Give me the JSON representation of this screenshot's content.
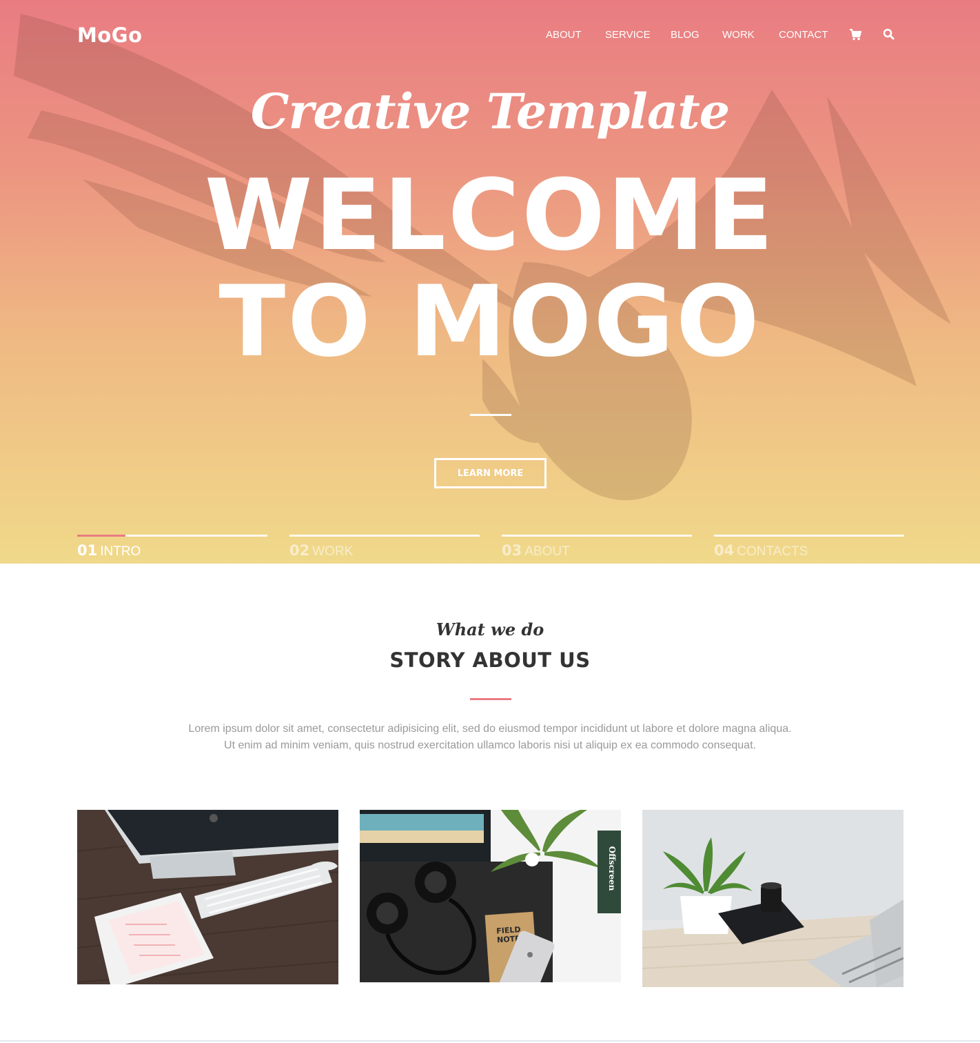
{
  "header": {
    "logo": "MoGo",
    "nav": [
      "ABOUT",
      "SERVICE",
      "BLOG",
      "WORK",
      "CONTACT"
    ],
    "icons": [
      "cart-icon",
      "search-icon"
    ]
  },
  "hero": {
    "script_title": "Creative Template",
    "title_line1": "WELCOME",
    "title_line2": "TO MOGO",
    "button_label": "LEARN MORE",
    "slider": [
      {
        "num": "01",
        "label": "INTRO",
        "active": true
      },
      {
        "num": "02",
        "label": "WORK",
        "active": false
      },
      {
        "num": "03",
        "label": "ABOUT",
        "active": false
      },
      {
        "num": "04",
        "label": "CONTACTS",
        "active": false
      }
    ]
  },
  "story": {
    "subheading": "What we do",
    "title": "STORY ABOUT US",
    "paragraph_line1": "Lorem ipsum dolor sit amet, consectetur adipisicing elit, sed do eiusmod tempor incididunt ut labore et dolore magna aliqua.",
    "paragraph_line2": "Ut enim ad minim veniam, quis nostrud exercitation ullamco laboris nisi ut aliquip ex ea commodo consequat.",
    "photos": [
      {
        "name": "desk-imac-photo"
      },
      {
        "name": "headphones-notebook-photo",
        "notebook_text_1": "FIELD",
        "notebook_text_2": "NOTES",
        "book_spine": "Offscreen"
      },
      {
        "name": "plant-camera-photo"
      }
    ]
  },
  "colors": {
    "accent": "#e97c82",
    "gradient_top": "#e97c82",
    "gradient_bottom": "#f0d98a",
    "heading": "#333333",
    "body_text": "#999999"
  }
}
